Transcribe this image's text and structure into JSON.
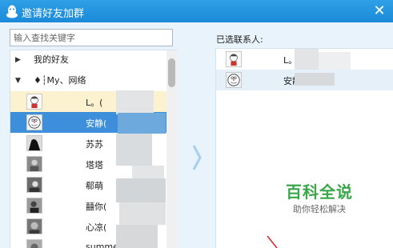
{
  "window": {
    "title": "邀请好友加群",
    "close_glyph": "✕"
  },
  "search": {
    "placeholder": "输入查找关键字",
    "value": ""
  },
  "friend_tree": {
    "groups": [
      {
        "label": "我的好友",
        "expanded": false,
        "arrow": "▶"
      },
      {
        "label": "♦┆My、网络",
        "expanded": true,
        "arrow": "▼"
      }
    ],
    "contacts": [
      {
        "name": "L。(",
        "state": "hover",
        "avatar_icon": "cartoon-boy-avatar-icon"
      },
      {
        "name": "安静(",
        "suffix": ")",
        "state": "selected",
        "avatar_icon": "doraemon-avatar-icon"
      },
      {
        "name": "苏苏",
        "state": "normal",
        "avatar_icon": "dark-silhouette-avatar-icon"
      },
      {
        "name": "塔塔",
        "state": "normal",
        "avatar_icon": "photo-avatar-icon"
      },
      {
        "name": "郗萌",
        "state": "normal",
        "avatar_icon": "photo-avatar-icon"
      },
      {
        "name": "囍你(",
        "state": "normal",
        "avatar_icon": "photo-avatar-icon"
      },
      {
        "name": "心凉(",
        "state": "normal",
        "avatar_icon": "photo-avatar-icon"
      },
      {
        "name": "summer",
        "state": "normal",
        "avatar_icon": "photo-avatar-icon"
      }
    ]
  },
  "transfer": {
    "arrow_glyph": "〉"
  },
  "selected_panel": {
    "header": "已选联系人:",
    "items": [
      {
        "name": "L。",
        "avatar_icon": "cartoon-boy-avatar-icon"
      },
      {
        "name": "安静",
        "avatar_icon": "doraemon-avatar-icon"
      }
    ]
  },
  "watermark": {
    "title": "百科全说",
    "subtitle": "助你轻松解决"
  },
  "colors": {
    "titlebar": "#1b8ad9",
    "selected_row": "#3d8fdc",
    "hover_row": "#fcf2cf",
    "watermark_green": "#3aa64a"
  }
}
